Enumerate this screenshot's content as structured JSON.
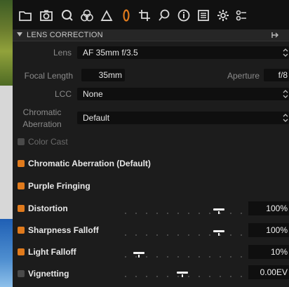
{
  "section": {
    "title": "LENS CORRECTION"
  },
  "lens": {
    "label": "Lens",
    "value": "AF 35mm f/3.5"
  },
  "focal": {
    "label": "Focal Length",
    "value": "35mm"
  },
  "aperture": {
    "label": "Aperture",
    "value": "f/8"
  },
  "lcc": {
    "label": "LCC",
    "value": "None"
  },
  "chromatic": {
    "label_line1": "Chromatic",
    "label_line2": "Aberration",
    "value": "Default"
  },
  "checks": {
    "color_cast": {
      "label": "Color Cast",
      "checked": false
    },
    "chromatic_aberration": {
      "label": "Chromatic Aberration (Default)",
      "checked": true
    },
    "purple_fringing": {
      "label": "Purple Fringing",
      "checked": true
    }
  },
  "sliders": {
    "distortion": {
      "label": "Distortion",
      "value": "100%",
      "level": 0.82,
      "checked": true
    },
    "sharpness_falloff": {
      "label": "Sharpness Falloff",
      "value": "100%",
      "level": 0.82,
      "checked": true
    },
    "light_falloff": {
      "label": "Light Falloff",
      "value": "10%",
      "level": 0.12,
      "checked": true
    },
    "vignetting": {
      "label": "Vignetting",
      "value": "0.00EV",
      "level": 0.5,
      "checked": false
    }
  },
  "toolbar_icons": [
    "folder-icon",
    "camera-icon",
    "search-icon",
    "color-circles-icon",
    "triangle-icon",
    "lens-icon",
    "crop-icon",
    "heal-icon",
    "info-icon",
    "list-icon",
    "gear-icon",
    "batch-icon"
  ],
  "colors": {
    "accent": "#e07a1c",
    "panel": "#1c1c1c"
  }
}
